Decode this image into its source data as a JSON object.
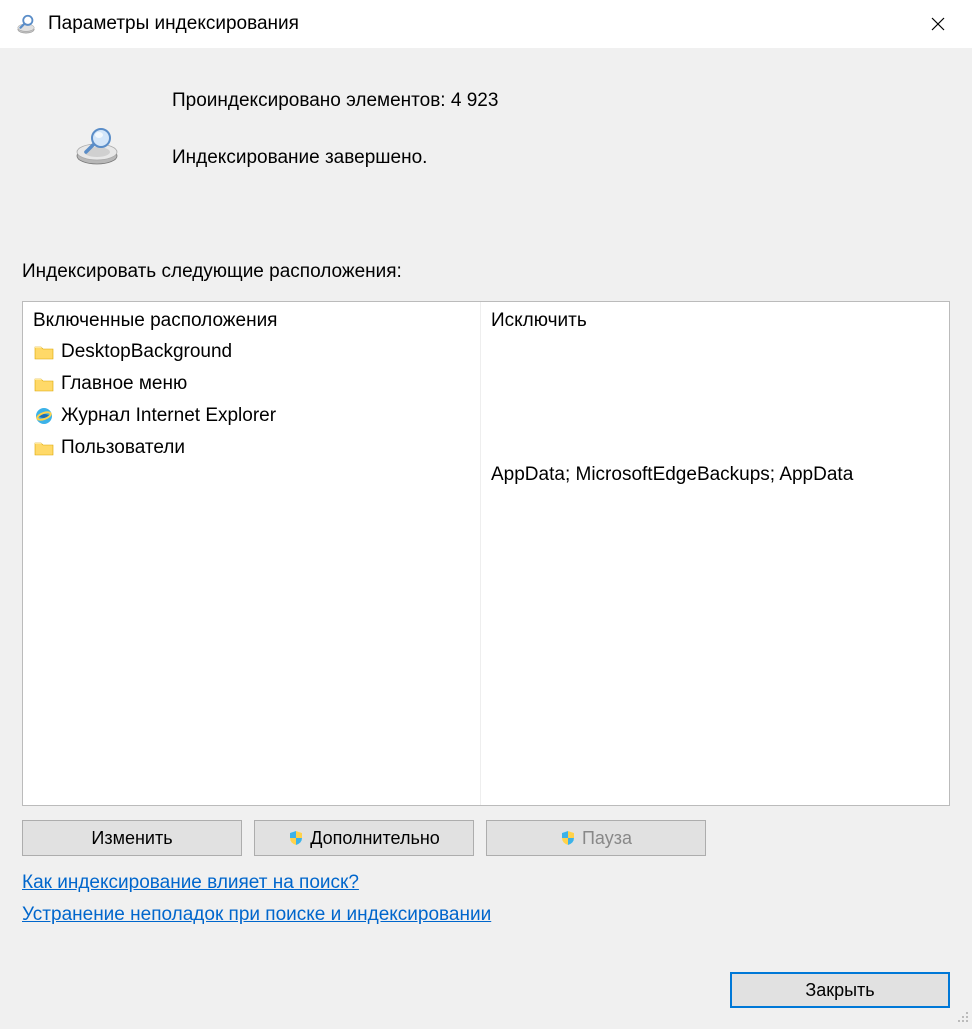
{
  "window": {
    "title": "Параметры индексирования"
  },
  "status": {
    "indexed_line": "Проиндексировано элементов: 4 923",
    "state_line": "Индексирование завершено."
  },
  "locations_label": "Индексировать следующие расположения:",
  "table": {
    "header_included": "Включенные расположения",
    "header_excluded": "Исключить",
    "rows": [
      {
        "label": "DesktopBackground",
        "icon": "folder",
        "excluded": ""
      },
      {
        "label": "Главное меню",
        "icon": "folder",
        "excluded": ""
      },
      {
        "label": "Журнал Internet Explorer",
        "icon": "ie",
        "excluded": ""
      },
      {
        "label": "Пользователи",
        "icon": "folder",
        "excluded": "AppData; MicrosoftEdgeBackups; AppData"
      }
    ]
  },
  "buttons": {
    "modify": "Изменить",
    "advanced": "Дополнительно",
    "pause": "Пауза",
    "close": "Закрыть"
  },
  "links": {
    "how_affects": "Как индексирование влияет на поиск?",
    "troubleshoot": "Устранение неполадок при поиске и индексировании"
  }
}
